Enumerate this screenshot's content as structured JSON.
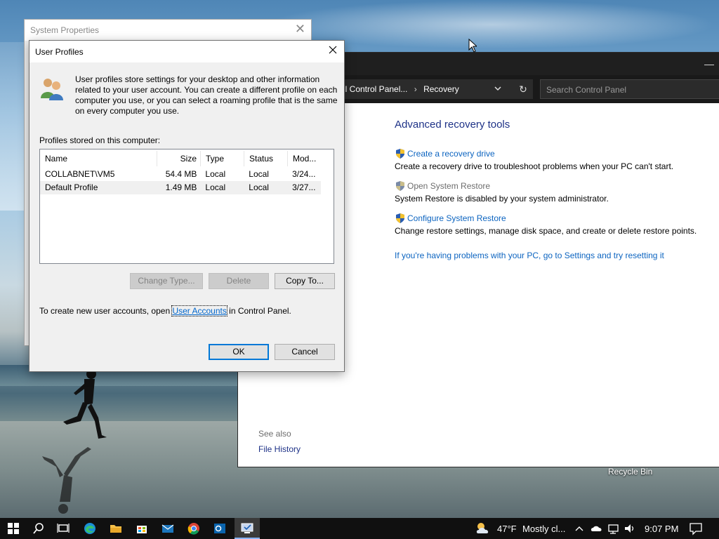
{
  "desktop": {
    "recycle_bin_label": "Recycle Bin"
  },
  "control_panel": {
    "breadcrumb": [
      "ll Control Panel...",
      "Recovery"
    ],
    "search_placeholder": "Search Control Panel",
    "heading": "Advanced recovery tools",
    "tools": [
      {
        "label": "Create a recovery drive",
        "desc": "Create a recovery drive to troubleshoot problems when your PC can't start.",
        "enabled": true
      },
      {
        "label": "Open System Restore",
        "desc": "System Restore is disabled by your system administrator.",
        "enabled": false
      },
      {
        "label": "Configure System Restore",
        "desc": "Change restore settings, manage disk space, and create or delete restore points.",
        "enabled": true
      }
    ],
    "reset_link": "If you're having problems with your PC, go to Settings and try resetting it",
    "see_also": "See also",
    "file_history": "File History"
  },
  "system_properties": {
    "title": "System Properties"
  },
  "user_profiles": {
    "title": "User Profiles",
    "intro": "User profiles store settings for your desktop and other information related to your user account. You can create a different profile on each computer you use, or you can select a roaming profile that is the same on every computer you use.",
    "profiles_label": "Profiles stored on this computer:",
    "columns": [
      "Name",
      "Size",
      "Type",
      "Status",
      "Mod..."
    ],
    "rows": [
      {
        "name": "COLLABNET\\VM5",
        "size": "54.4 MB",
        "type": "Local",
        "status": "Local",
        "mod": "3/24..."
      },
      {
        "name": "Default Profile",
        "size": "1.49 MB",
        "type": "Local",
        "status": "Local",
        "mod": "3/27..."
      }
    ],
    "buttons": {
      "change_type": "Change Type...",
      "delete": "Delete",
      "copy_to": "Copy To...",
      "ok": "OK",
      "cancel": "Cancel"
    },
    "accounts_prefix": "To create new user accounts, open ",
    "accounts_link": "User Accounts",
    "accounts_suffix": " in Control Panel."
  },
  "taskbar": {
    "weather_temp": "47°F",
    "weather_desc": "Mostly cl...",
    "time": "9:07 PM",
    "icons": [
      "windows-start",
      "search",
      "task-view",
      "edge",
      "file-explorer",
      "store",
      "mail",
      "chrome",
      "outlook",
      "system-properties"
    ]
  }
}
